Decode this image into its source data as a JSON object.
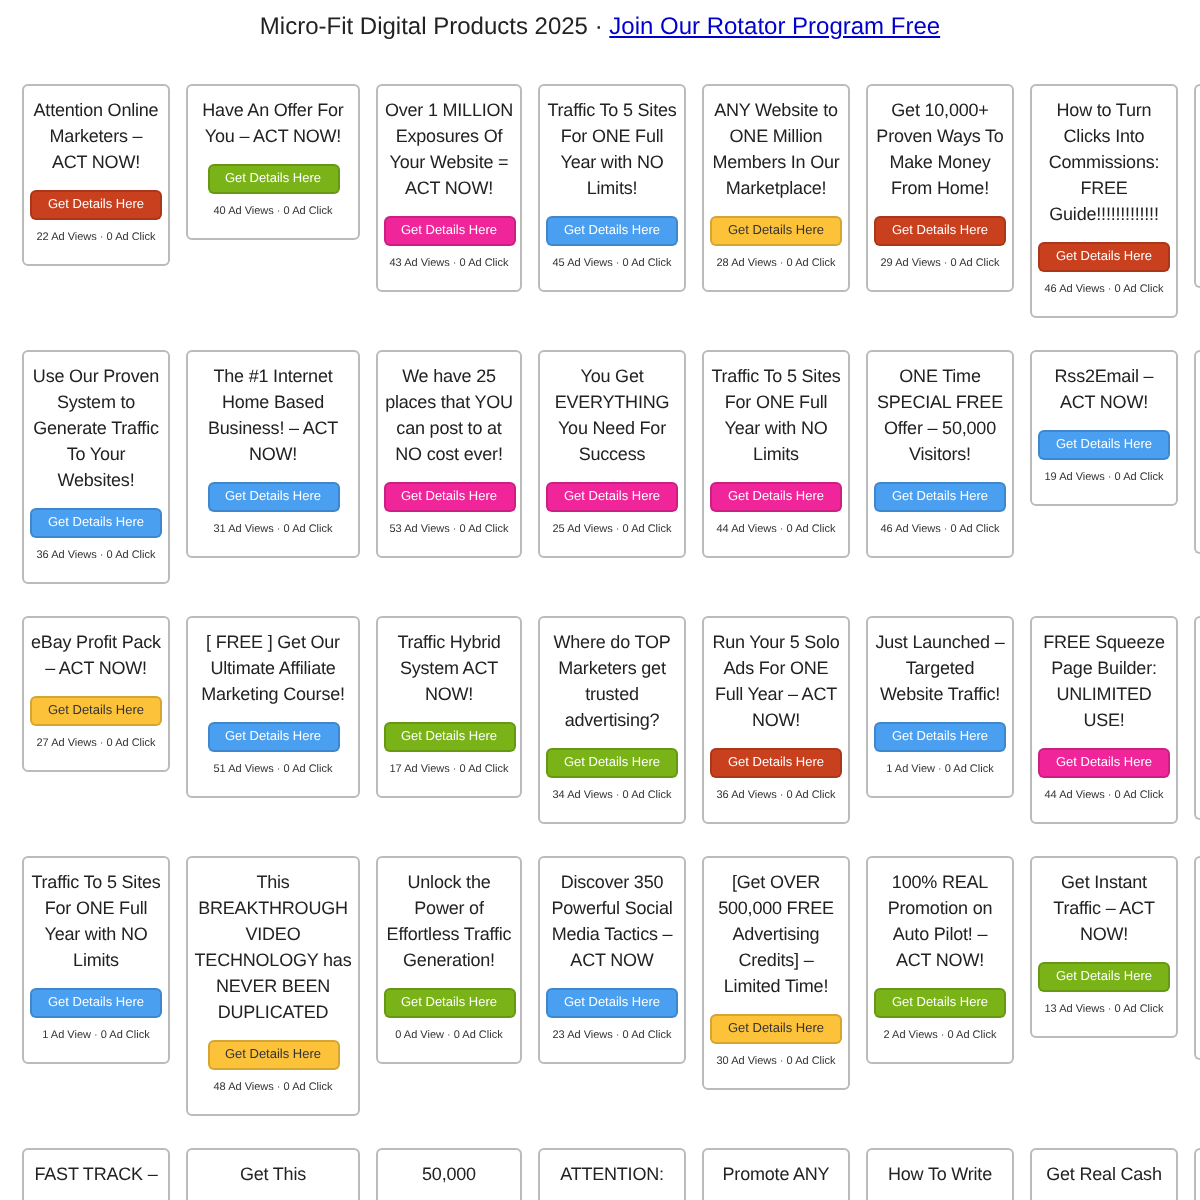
{
  "header": {
    "title": "Micro-Fit Digital Products 2025 · ",
    "link": "Join Our Rotator Program Free"
  },
  "cards": [
    {
      "title": "Attention Online Marketers – ACT NOW!",
      "button": "Get Details Here",
      "color": "#c9401f",
      "stats": "22 Ad Views · 0 Ad Click"
    },
    {
      "title": "Have An Offer For You – ACT NOW!",
      "button": "Get Details Here",
      "color": "#7ab317",
      "stats": "40 Ad Views · 0 Ad Click"
    },
    {
      "title": "Over 1 MILLION Exposures Of Your Website = ACT NOW!",
      "button": "Get Details Here",
      "color": "#f0259a",
      "stats": "43 Ad Views · 0 Ad Click"
    },
    {
      "title": "Traffic To 5 Sites For ONE Full Year with NO Limits!",
      "button": "Get Details Here",
      "color": "#4a9ff0",
      "stats": "45 Ad Views · 0 Ad Click"
    },
    {
      "title": "ANY Website to ONE Million Members In Our Marketplace!",
      "button": "Get Details Here",
      "color": "#fcc23a",
      "stats": "28 Ad Views · 0 Ad Click"
    },
    {
      "title": "Get 10,000+ Proven Ways To Make Money From Home!",
      "button": "Get Details Here",
      "color": "#c9401f",
      "stats": "29 Ad Views · 0 Ad Click"
    },
    {
      "title": "How to Turn Clicks Into Commissions: FREE Guide!!!!!!!!!!!!!",
      "button": "Get Details Here",
      "color": "#c9401f",
      "stats": "46 Ad Views · 0 Ad Click"
    },
    {
      "title": "Use Our Proven System to Generate Traffic To Your Websites!",
      "button": "Get Details Here",
      "color": "#4a9ff0",
      "stats": "36 Ad Views · 0 Ad Click"
    },
    {
      "title": "The #1 Internet Home Based Business! – ACT NOW!",
      "button": "Get Details Here",
      "color": "#4a9ff0",
      "stats": "31 Ad Views · 0 Ad Click"
    },
    {
      "title": "We have 25 places that YOU can post to at NO cost ever!",
      "button": "Get Details Here",
      "color": "#f0259a",
      "stats": "53 Ad Views · 0 Ad Click"
    },
    {
      "title": "You Get EVERYTHING You Need For Success",
      "button": "Get Details Here",
      "color": "#f0259a",
      "stats": "25 Ad Views · 0 Ad Click"
    },
    {
      "title": "Traffic To 5 Sites For ONE Full Year with NO Limits",
      "button": "Get Details Here",
      "color": "#f0259a",
      "stats": "44 Ad Views · 0 Ad Click"
    },
    {
      "title": "ONE Time SPECIAL FREE Offer – 50,000 Visitors!",
      "button": "Get Details Here",
      "color": "#4a9ff0",
      "stats": "46 Ad Views · 0 Ad Click"
    },
    {
      "title": "Rss2Email – ACT NOW!",
      "button": "Get Details Here",
      "color": "#4a9ff0",
      "stats": "19 Ad Views · 0 Ad Click"
    },
    {
      "title": "eBay Profit Pack – ACT NOW!",
      "button": "Get Details Here",
      "color": "#fcc23a",
      "stats": "27 Ad Views · 0 Ad Click"
    },
    {
      "title": "[ FREE ] Get Our Ultimate Affiliate Marketing Course!",
      "button": "Get Details Here",
      "color": "#4a9ff0",
      "stats": "51 Ad Views · 0 Ad Click"
    },
    {
      "title": "Traffic Hybrid System ACT NOW!",
      "button": "Get Details Here",
      "color": "#7ab317",
      "stats": "17 Ad Views · 0 Ad Click"
    },
    {
      "title": "Where do TOP Marketers get trusted advertising?",
      "button": "Get Details Here",
      "color": "#7ab317",
      "stats": "34 Ad Views · 0 Ad Click"
    },
    {
      "title": "Run Your 5 Solo Ads For ONE Full Year – ACT NOW!",
      "button": "Get Details Here",
      "color": "#c9401f",
      "stats": "36 Ad Views · 0 Ad Click"
    },
    {
      "title": "Just Launched – Targeted Website Traffic!",
      "button": "Get Details Here",
      "color": "#4a9ff0",
      "stats": "1 Ad View · 0 Ad Click"
    },
    {
      "title": "FREE Squeeze Page Builder: UNLIMITED USE!",
      "button": "Get Details Here",
      "color": "#f0259a",
      "stats": "44 Ad Views · 0 Ad Click"
    },
    {
      "title": "Traffic To 5 Sites For ONE Full Year with NO Limits",
      "button": "Get Details Here",
      "color": "#4a9ff0",
      "stats": "1 Ad View · 0 Ad Click"
    },
    {
      "title": "This BREAKTHROUGH VIDEO TECHNOLOGY has NEVER BEEN DUPLICATED",
      "button": "Get Details Here",
      "color": "#fcc23a",
      "stats": "48 Ad Views · 0 Ad Click"
    },
    {
      "title": "Unlock the Power of Effortless Traffic Generation!",
      "button": "Get Details Here",
      "color": "#7ab317",
      "stats": "0 Ad View · 0 Ad Click"
    },
    {
      "title": "Discover 350 Powerful Social Media Tactics – ACT NOW",
      "button": "Get Details Here",
      "color": "#4a9ff0",
      "stats": "23 Ad Views · 0 Ad Click"
    },
    {
      "title": "[Get OVER 500,000 FREE Advertising Credits] – Limited Time!",
      "button": "Get Details Here",
      "color": "#fcc23a",
      "stats": "30 Ad Views · 0 Ad Click"
    },
    {
      "title": "100% REAL Promotion on Auto Pilot! – ACT NOW!",
      "button": "Get Details Here",
      "color": "#7ab317",
      "stats": "2 Ad Views · 0 Ad Click"
    },
    {
      "title": "Get Instant Traffic – ACT NOW!",
      "button": "Get Details Here",
      "color": "#7ab317",
      "stats": "13 Ad Views · 0 Ad Click"
    },
    {
      "title": "FAST TRACK –"
    },
    {
      "title": "Get This"
    },
    {
      "title": "50,000"
    },
    {
      "title": "ATTENTION:"
    },
    {
      "title": "Promote ANY"
    },
    {
      "title": "How To Write"
    },
    {
      "title": "Get Real Cash"
    }
  ]
}
